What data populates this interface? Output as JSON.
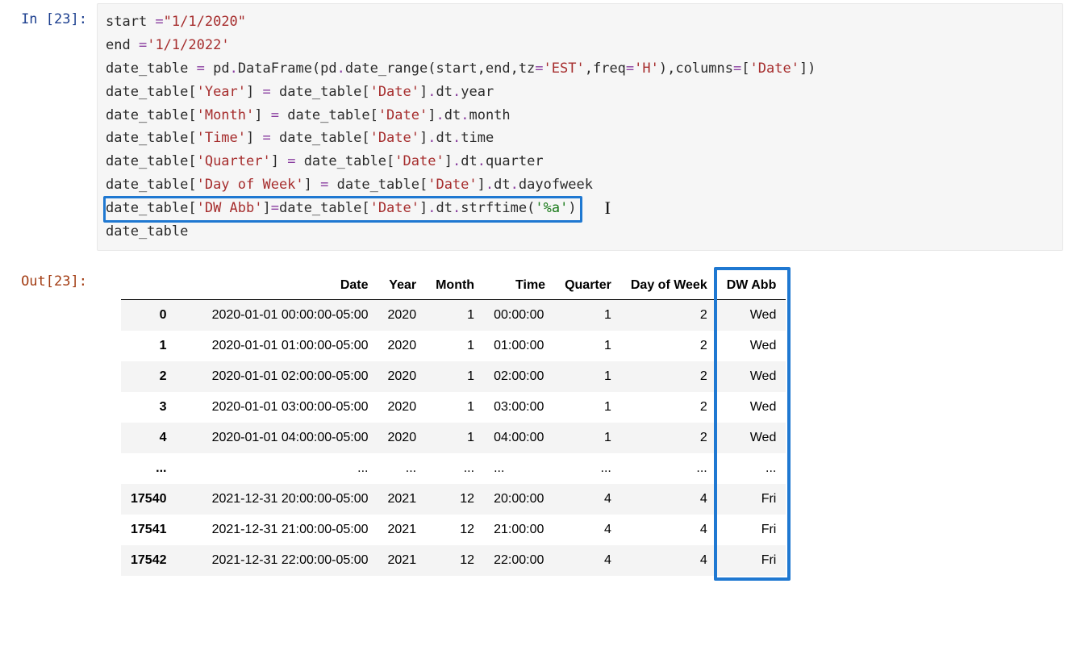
{
  "prompt": {
    "in_label_prefix": "In ",
    "out_label_prefix": "Out",
    "exec_count": "23"
  },
  "code": {
    "lines": [
      [
        {
          "t": "ident",
          "v": "start "
        },
        {
          "t": "op",
          "v": "="
        },
        {
          "t": "str",
          "v": "\"1/1/2020\""
        }
      ],
      [
        {
          "t": "ident",
          "v": "end "
        },
        {
          "t": "op",
          "v": "="
        },
        {
          "t": "str",
          "v": "'1/1/2022'"
        }
      ],
      [
        {
          "t": "ident",
          "v": "date_table "
        },
        {
          "t": "op",
          "v": "="
        },
        {
          "t": "ident",
          "v": " pd"
        },
        {
          "t": "op",
          "v": "."
        },
        {
          "t": "ident",
          "v": "DataFrame(pd"
        },
        {
          "t": "op",
          "v": "."
        },
        {
          "t": "ident",
          "v": "date_range(start,end,tz"
        },
        {
          "t": "op",
          "v": "="
        },
        {
          "t": "str",
          "v": "'EST'"
        },
        {
          "t": "ident",
          "v": ",freq"
        },
        {
          "t": "op",
          "v": "="
        },
        {
          "t": "str",
          "v": "'H'"
        },
        {
          "t": "ident",
          "v": "),columns"
        },
        {
          "t": "op",
          "v": "="
        },
        {
          "t": "ident",
          "v": "["
        },
        {
          "t": "str",
          "v": "'Date'"
        },
        {
          "t": "ident",
          "v": "])"
        }
      ],
      [
        {
          "t": "ident",
          "v": "date_table["
        },
        {
          "t": "str",
          "v": "'Year'"
        },
        {
          "t": "ident",
          "v": "] "
        },
        {
          "t": "op",
          "v": "="
        },
        {
          "t": "ident",
          "v": " date_table["
        },
        {
          "t": "str",
          "v": "'Date'"
        },
        {
          "t": "ident",
          "v": "]"
        },
        {
          "t": "op",
          "v": "."
        },
        {
          "t": "ident",
          "v": "dt"
        },
        {
          "t": "op",
          "v": "."
        },
        {
          "t": "ident",
          "v": "year"
        }
      ],
      [
        {
          "t": "ident",
          "v": "date_table["
        },
        {
          "t": "str",
          "v": "'Month'"
        },
        {
          "t": "ident",
          "v": "] "
        },
        {
          "t": "op",
          "v": "="
        },
        {
          "t": "ident",
          "v": " date_table["
        },
        {
          "t": "str",
          "v": "'Date'"
        },
        {
          "t": "ident",
          "v": "]"
        },
        {
          "t": "op",
          "v": "."
        },
        {
          "t": "ident",
          "v": "dt"
        },
        {
          "t": "op",
          "v": "."
        },
        {
          "t": "ident",
          "v": "month"
        }
      ],
      [
        {
          "t": "ident",
          "v": "date_table["
        },
        {
          "t": "str",
          "v": "'Time'"
        },
        {
          "t": "ident",
          "v": "] "
        },
        {
          "t": "op",
          "v": "="
        },
        {
          "t": "ident",
          "v": " date_table["
        },
        {
          "t": "str",
          "v": "'Date'"
        },
        {
          "t": "ident",
          "v": "]"
        },
        {
          "t": "op",
          "v": "."
        },
        {
          "t": "ident",
          "v": "dt"
        },
        {
          "t": "op",
          "v": "."
        },
        {
          "t": "ident",
          "v": "time"
        }
      ],
      [
        {
          "t": "ident",
          "v": "date_table["
        },
        {
          "t": "str",
          "v": "'Quarter'"
        },
        {
          "t": "ident",
          "v": "] "
        },
        {
          "t": "op",
          "v": "="
        },
        {
          "t": "ident",
          "v": " date_table["
        },
        {
          "t": "str",
          "v": "'Date'"
        },
        {
          "t": "ident",
          "v": "]"
        },
        {
          "t": "op",
          "v": "."
        },
        {
          "t": "ident",
          "v": "dt"
        },
        {
          "t": "op",
          "v": "."
        },
        {
          "t": "ident",
          "v": "quarter"
        }
      ],
      [
        {
          "t": "ident",
          "v": "date_table["
        },
        {
          "t": "str",
          "v": "'Day of Week'"
        },
        {
          "t": "ident",
          "v": "] "
        },
        {
          "t": "op",
          "v": "="
        },
        {
          "t": "ident",
          "v": " date_table["
        },
        {
          "t": "str",
          "v": "'Date'"
        },
        {
          "t": "ident",
          "v": "]"
        },
        {
          "t": "op",
          "v": "."
        },
        {
          "t": "ident",
          "v": "dt"
        },
        {
          "t": "op",
          "v": "."
        },
        {
          "t": "ident",
          "v": "dayofweek"
        }
      ],
      [
        {
          "t": "ident",
          "v": "date_table["
        },
        {
          "t": "str",
          "v": "'DW Abb'"
        },
        {
          "t": "ident",
          "v": "]"
        },
        {
          "t": "op",
          "v": "="
        },
        {
          "t": "ident",
          "v": "date_table["
        },
        {
          "t": "str",
          "v": "'Date'"
        },
        {
          "t": "ident",
          "v": "]"
        },
        {
          "t": "op",
          "v": "."
        },
        {
          "t": "ident",
          "v": "dt"
        },
        {
          "t": "op",
          "v": "."
        },
        {
          "t": "ident",
          "v": "strftime("
        },
        {
          "t": "num",
          "v": "'%a'"
        },
        {
          "t": "ident",
          "v": ")"
        }
      ],
      [
        {
          "t": "ident",
          "v": "date_table"
        }
      ]
    ]
  },
  "output": {
    "columns": [
      "Date",
      "Year",
      "Month",
      "Time",
      "Quarter",
      "Day of Week",
      "DW Abb"
    ],
    "rows": [
      {
        "idx": "0",
        "Date": "2020-01-01 00:00:00-05:00",
        "Year": "2020",
        "Month": "1",
        "Time": "00:00:00",
        "Quarter": "1",
        "Day of Week": "2",
        "DW Abb": "Wed"
      },
      {
        "idx": "1",
        "Date": "2020-01-01 01:00:00-05:00",
        "Year": "2020",
        "Month": "1",
        "Time": "01:00:00",
        "Quarter": "1",
        "Day of Week": "2",
        "DW Abb": "Wed"
      },
      {
        "idx": "2",
        "Date": "2020-01-01 02:00:00-05:00",
        "Year": "2020",
        "Month": "1",
        "Time": "02:00:00",
        "Quarter": "1",
        "Day of Week": "2",
        "DW Abb": "Wed"
      },
      {
        "idx": "3",
        "Date": "2020-01-01 03:00:00-05:00",
        "Year": "2020",
        "Month": "1",
        "Time": "03:00:00",
        "Quarter": "1",
        "Day of Week": "2",
        "DW Abb": "Wed"
      },
      {
        "idx": "4",
        "Date": "2020-01-01 04:00:00-05:00",
        "Year": "2020",
        "Month": "1",
        "Time": "04:00:00",
        "Quarter": "1",
        "Day of Week": "2",
        "DW Abb": "Wed"
      },
      {
        "idx": "...",
        "Date": "...",
        "Year": "...",
        "Month": "...",
        "Time": "...",
        "Quarter": "...",
        "Day of Week": "...",
        "DW Abb": "..."
      },
      {
        "idx": "17540",
        "Date": "2021-12-31 20:00:00-05:00",
        "Year": "2021",
        "Month": "12",
        "Time": "20:00:00",
        "Quarter": "4",
        "Day of Week": "4",
        "DW Abb": "Fri"
      },
      {
        "idx": "17541",
        "Date": "2021-12-31 21:00:00-05:00",
        "Year": "2021",
        "Month": "12",
        "Time": "21:00:00",
        "Quarter": "4",
        "Day of Week": "4",
        "DW Abb": "Fri"
      },
      {
        "idx": "17542",
        "Date": "2021-12-31 22:00:00-05:00",
        "Year": "2021",
        "Month": "12",
        "Time": "22:00:00",
        "Quarter": "4",
        "Day of Week": "4",
        "DW Abb": "Fri"
      }
    ]
  },
  "annotations": {
    "code_highlight_line": 8,
    "output_highlight_column": "DW Abb"
  }
}
